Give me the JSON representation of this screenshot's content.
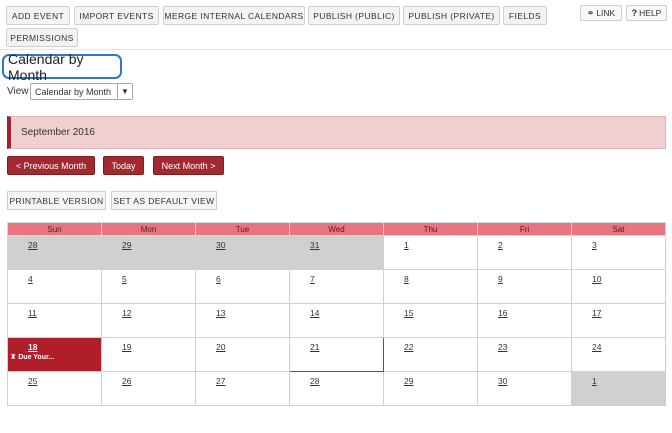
{
  "toolbar": {
    "buttons": [
      "ADD EVENT",
      "IMPORT EVENTS",
      "MERGE INTERNAL CALENDARS",
      "PUBLISH (PUBLIC)",
      "PUBLISH (PRIVATE)",
      "FIELDS",
      "PERMISSIONS"
    ],
    "link_label": "LINK",
    "help_label": "HELP"
  },
  "page_title": "Calendar by Month",
  "view": {
    "label": "View",
    "selected": "Calendar by Month"
  },
  "month_label": "September 2016",
  "nav": {
    "prev": "< Previous Month",
    "today": "Today",
    "next": "Next Month >"
  },
  "sub_buttons": [
    "PRINTABLE VERSION",
    "SET AS DEFAULT VIEW"
  ],
  "calendar": {
    "weekdays": [
      "Sun",
      "Mon",
      "Tue",
      "Wed",
      "Thu",
      "Fri",
      "Sat"
    ],
    "weeks": [
      [
        "28",
        "29",
        "30",
        "31",
        "1",
        "2",
        "3"
      ],
      [
        "4",
        "5",
        "6",
        "7",
        "8",
        "9",
        "10"
      ],
      [
        "11",
        "12",
        "13",
        "14",
        "15",
        "16",
        "17"
      ],
      [
        "18",
        "19",
        "20",
        "21",
        "22",
        "23",
        "24"
      ],
      [
        "25",
        "26",
        "27",
        "28",
        "29",
        "30",
        "1"
      ]
    ],
    "event": {
      "day": "18",
      "text": "Due Your..."
    }
  }
}
